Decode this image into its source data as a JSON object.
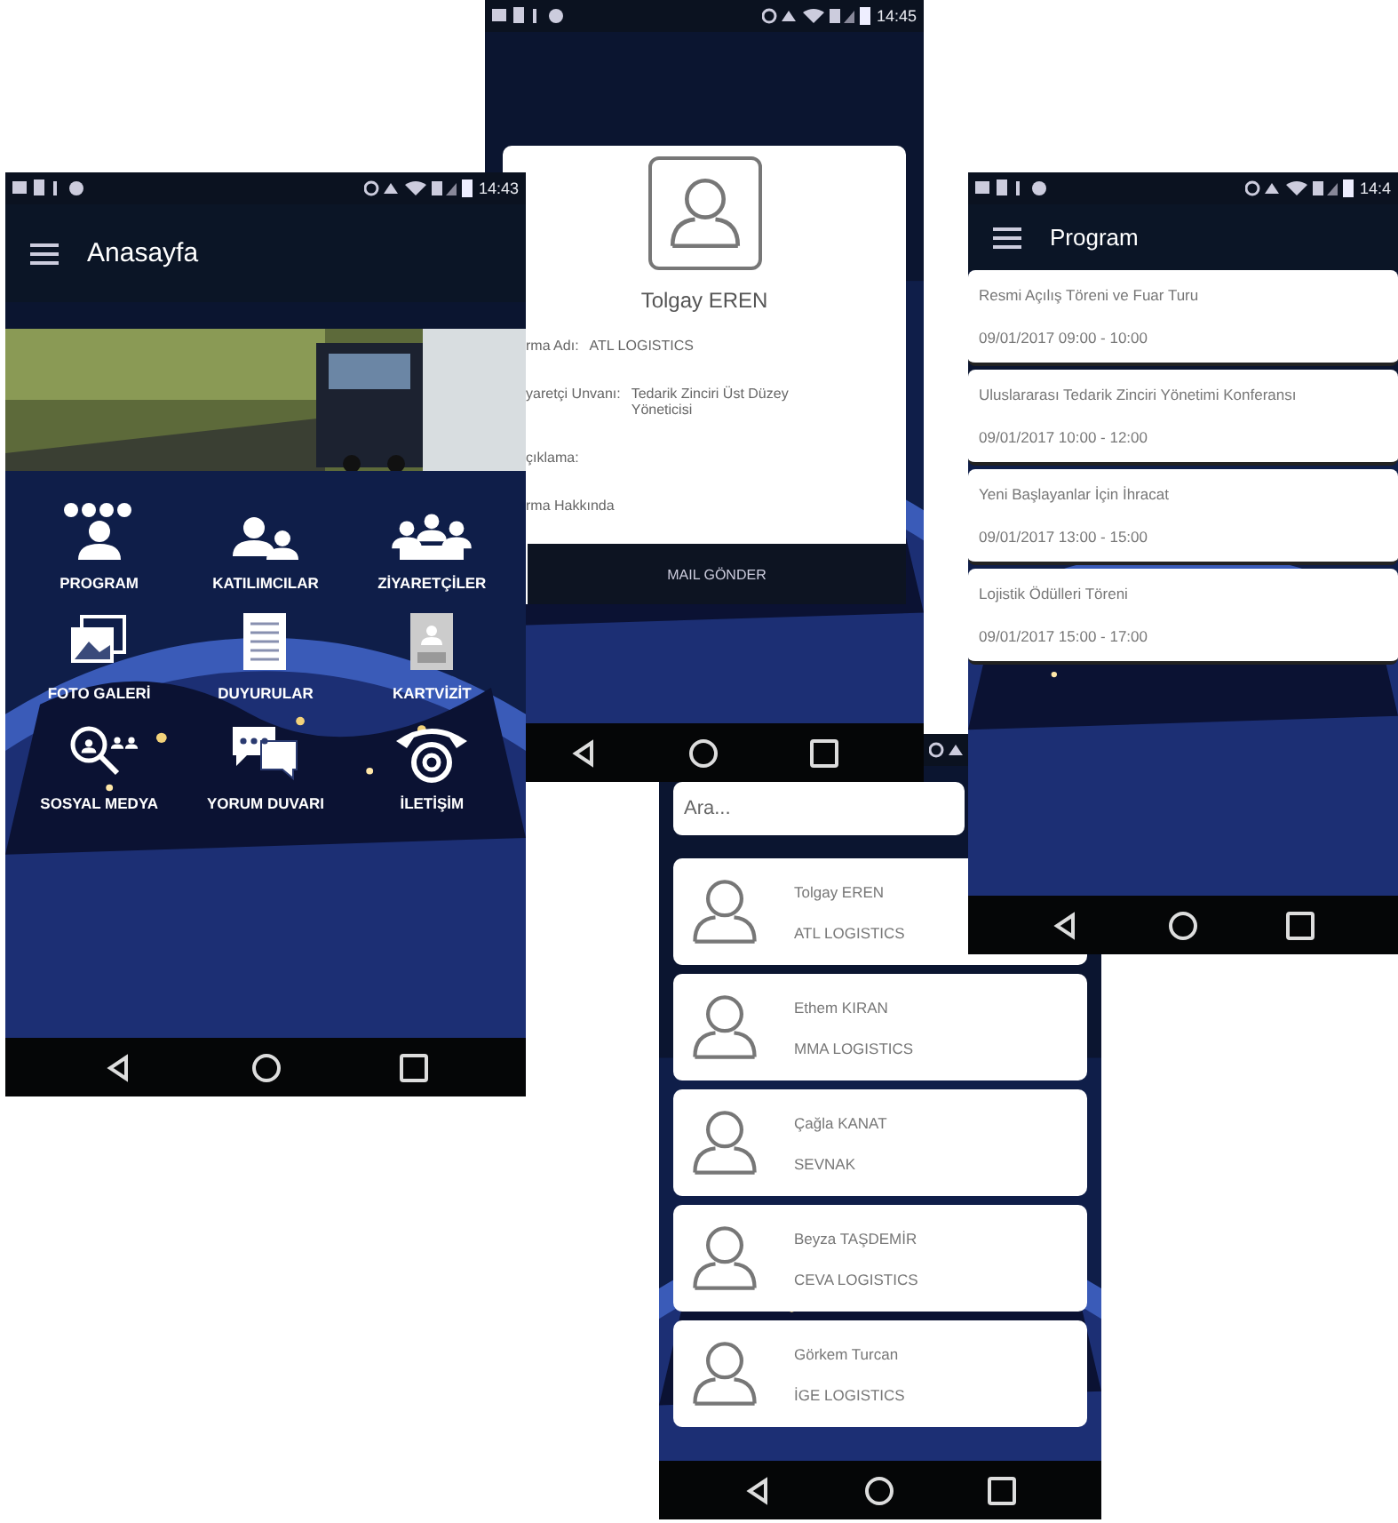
{
  "screens": [
    {
      "kind": "home",
      "status_time": "14:43",
      "title": "Anasayfa",
      "menu": [
        {
          "kind": "program",
          "label": "PROGRAM"
        },
        {
          "kind": "participants",
          "label": "KATILIMCILAR"
        },
        {
          "kind": "visitors",
          "label": "ZİYARETÇİLER"
        },
        {
          "kind": "gallery",
          "label": "FOTO GALERİ"
        },
        {
          "kind": "announcements",
          "label": "DUYURULAR"
        },
        {
          "kind": "card",
          "label": "KARTVİZİT"
        },
        {
          "kind": "social",
          "label": "SOSYAL MEDYA"
        },
        {
          "kind": "comments",
          "label": "YORUM DUVARI"
        },
        {
          "kind": "contact",
          "label": "İLETİŞİM"
        }
      ]
    },
    {
      "kind": "program",
      "status_time": "14:4",
      "title": "Program",
      "events": [
        {
          "title": "Resmi Açılış Töreni ve Fuar Turu",
          "time": "09/01/2017  09:00 - 10:00"
        },
        {
          "title": "Uluslararası Tedarik Zinciri Yönetimi Konferansı",
          "time": "09/01/2017  10:00 - 12:00"
        },
        {
          "title": "Yeni Başlayanlar İçin İhracat",
          "time": "09/01/2017  13:00 - 15:00"
        },
        {
          "title": "Lojistik Ödülleri Töreni",
          "time": "09/01/2017  15:00 - 17:00"
        }
      ]
    },
    {
      "kind": "profile",
      "status_time": "14:45",
      "name": "Tolgay  EREN",
      "fields": [
        {
          "label": "rma Adı:",
          "value": "ATL LOGISTICS"
        },
        {
          "label": "yaretçi Unvanı:",
          "value": "Tedarik Zinciri Üst Düzey Yöneticisi"
        },
        {
          "label": "çıklama:"
        },
        {
          "label": "rma Hakkında"
        }
      ],
      "button": "MAIL GÖNDER"
    },
    {
      "kind": "contacts",
      "search": {
        "placeholder": "Ara..."
      },
      "contacts": [
        {
          "name": "Tolgay  EREN",
          "company": "ATL LOGISTICS"
        },
        {
          "name": "Ethem KIRAN",
          "company": "MMA LOGISTICS"
        },
        {
          "name": "Çağla KANAT",
          "company": "SEVNAK"
        },
        {
          "name": "Beyza TAŞDEMİR",
          "company": "CEVA LOGISTICS"
        },
        {
          "name": "Görkem Turcan",
          "company": "İGE LOGISTICS"
        }
      ]
    }
  ]
}
